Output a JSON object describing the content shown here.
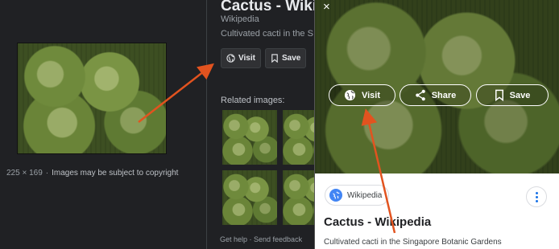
{
  "desktop": {
    "size_text": "225 × 169",
    "separator": "·",
    "copyright_note": "Images may be subject to copyright",
    "title": "Cactus - Wiki",
    "source": "Wikipedia",
    "description": "Cultivated cacti in the S",
    "visit_label": "Visit",
    "save_label": "Save",
    "related_label": "Related images:",
    "footer": "Get help · Send feedback"
  },
  "mobile": {
    "close_glyph": "×",
    "visit_label": "Visit",
    "share_label": "Share",
    "save_label": "Save",
    "chip_label": "Wikipedia",
    "title": "Cactus - Wikipedia",
    "description": "Cultivated cacti in the Singapore Botanic Gardens"
  },
  "colors": {
    "arrow": "#e2531f",
    "dark_bg": "#202124",
    "link_blue": "#1a73e8"
  }
}
